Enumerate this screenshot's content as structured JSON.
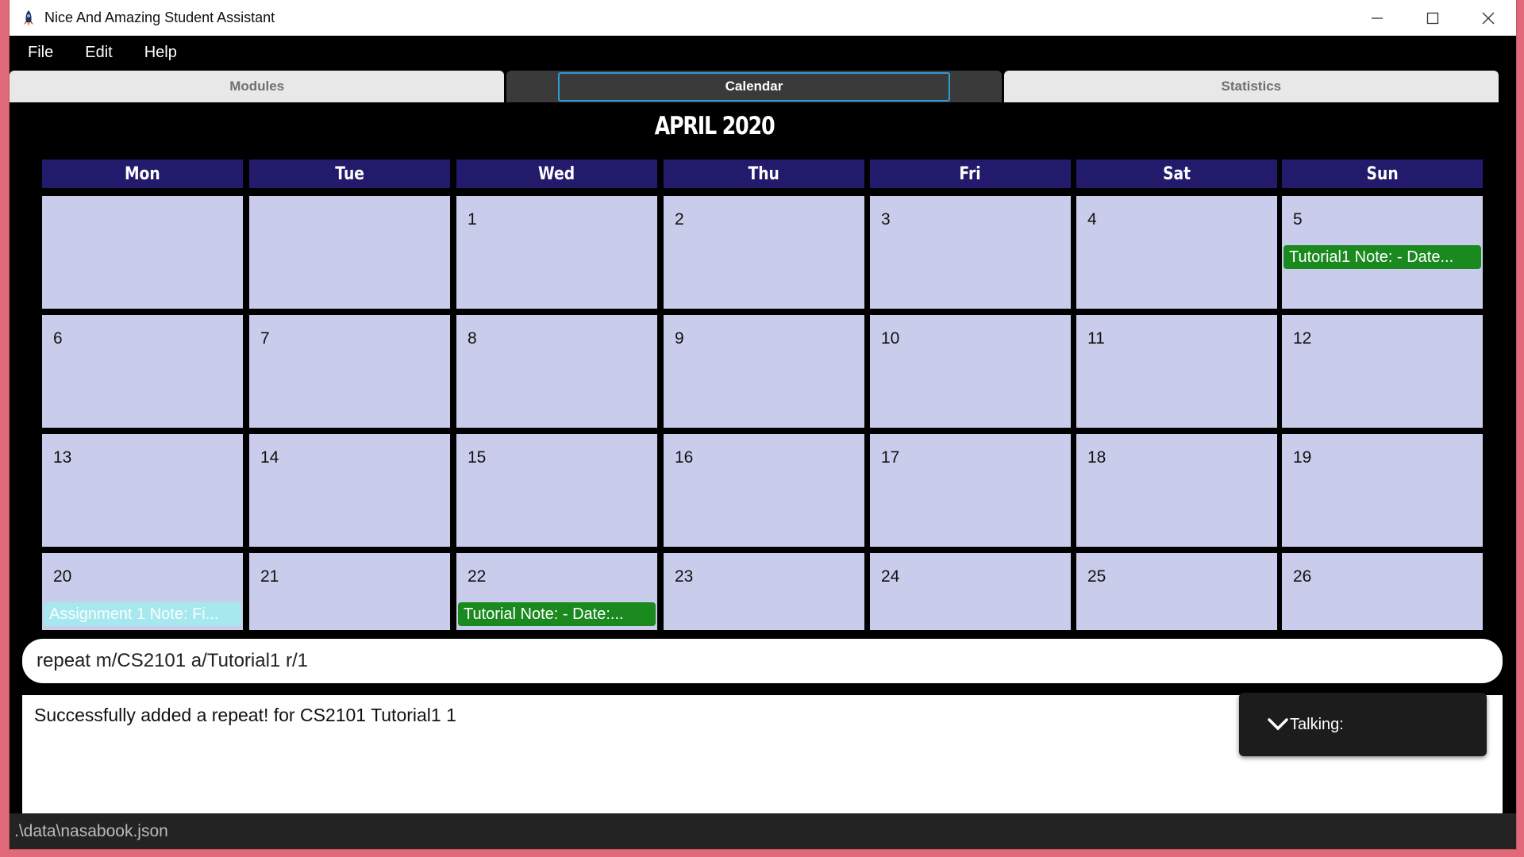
{
  "window": {
    "title": "Nice And Amazing Student Assistant",
    "icon": "app-rocket-icon",
    "controls": [
      "minimize-icon",
      "maximize-icon",
      "close-icon"
    ]
  },
  "menu": {
    "items": [
      "File",
      "Edit",
      "Help"
    ]
  },
  "tabs": [
    {
      "label": "Modules",
      "active": false
    },
    {
      "label": "Calendar",
      "active": true
    },
    {
      "label": "Statistics",
      "active": false
    }
  ],
  "calendar": {
    "title": "APRIL 2020",
    "weekdays": [
      "Mon",
      "Tue",
      "Wed",
      "Thu",
      "Fri",
      "Sat",
      "Sun"
    ],
    "weeks": [
      [
        {
          "day": ""
        },
        {
          "day": ""
        },
        {
          "day": "1"
        },
        {
          "day": "2"
        },
        {
          "day": "3"
        },
        {
          "day": "4"
        },
        {
          "day": "5",
          "event": "Tutorial1 Note: - Date...",
          "event_color": "green"
        }
      ],
      [
        {
          "day": "6"
        },
        {
          "day": "7"
        },
        {
          "day": "8"
        },
        {
          "day": "9"
        },
        {
          "day": "10"
        },
        {
          "day": "11"
        },
        {
          "day": "12"
        }
      ],
      [
        {
          "day": "13"
        },
        {
          "day": "14"
        },
        {
          "day": "15"
        },
        {
          "day": "16"
        },
        {
          "day": "17"
        },
        {
          "day": "18"
        },
        {
          "day": "19"
        }
      ],
      [
        {
          "day": "20",
          "event": "Assignment 1 Note: Fi...",
          "event_color": "cyan"
        },
        {
          "day": "21"
        },
        {
          "day": "22",
          "event": "Tutorial Note: - Date:...",
          "event_color": "green"
        },
        {
          "day": "23"
        },
        {
          "day": "24"
        },
        {
          "day": "25"
        },
        {
          "day": "26"
        }
      ]
    ]
  },
  "command": {
    "value": "repeat m/CS2101 a/Tutorial1 r/1"
  },
  "result": {
    "text": "Successfully added a repeat! for CS2101 Tutorial1 1"
  },
  "talking": {
    "label": "Talking:",
    "icon": "chevron-down-icon"
  },
  "status": {
    "path": ".\\data\\nasabook.json"
  },
  "colors": {
    "header_bg": "#221a6b",
    "cell_bg": "#c9cdeb",
    "event_green": "#1a8a1f",
    "event_cyan": "#a6e8ee",
    "focus": "#2f9ad6"
  }
}
